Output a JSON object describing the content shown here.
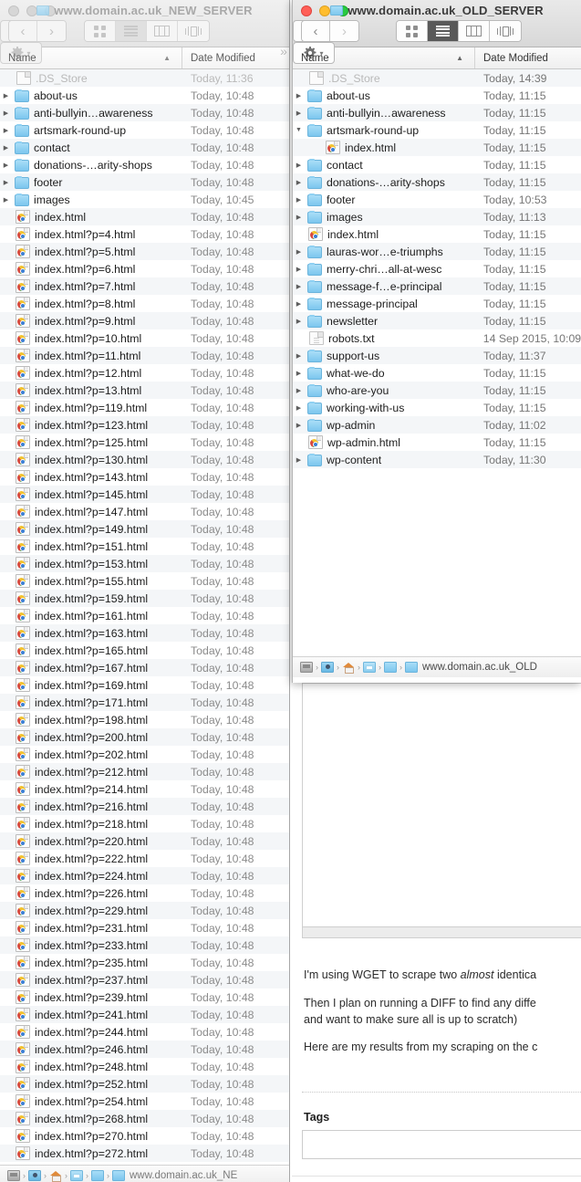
{
  "windows": [
    {
      "id": "new-server",
      "title": "www.domain.ac.uk_NEW_SERVER",
      "active": false,
      "columns": {
        "name": "Name",
        "date": "Date Modified"
      },
      "pathbar": {
        "label": "www.domain.ac.uk_NE"
      },
      "rows": [
        {
          "name": ".DS_Store",
          "date": "Today, 11:36",
          "icon": "document-icon",
          "ghost": true,
          "indent": 0,
          "disclosure": "none"
        },
        {
          "name": "about-us",
          "date": "Today, 10:48",
          "icon": "folder-icon",
          "indent": 0,
          "disclosure": "collapsed"
        },
        {
          "name": "anti-bullyin…awareness",
          "date": "Today, 10:48",
          "icon": "folder-icon",
          "indent": 0,
          "disclosure": "collapsed"
        },
        {
          "name": "artsmark-round-up",
          "date": "Today, 10:48",
          "icon": "folder-icon",
          "indent": 0,
          "disclosure": "collapsed"
        },
        {
          "name": "contact",
          "date": "Today, 10:48",
          "icon": "folder-icon",
          "indent": 0,
          "disclosure": "collapsed"
        },
        {
          "name": "donations-…arity-shops",
          "date": "Today, 10:48",
          "icon": "folder-icon",
          "indent": 0,
          "disclosure": "collapsed"
        },
        {
          "name": "footer",
          "date": "Today, 10:48",
          "icon": "folder-icon",
          "indent": 0,
          "disclosure": "collapsed"
        },
        {
          "name": "images",
          "date": "Today, 10:45",
          "icon": "folder-icon",
          "indent": 0,
          "disclosure": "collapsed"
        },
        {
          "name": "index.html",
          "date": "Today, 10:48",
          "icon": "html-file-icon",
          "indent": 0,
          "disclosure": "none"
        },
        {
          "name": "index.html?p=4.html",
          "date": "Today, 10:48",
          "icon": "html-file-icon",
          "indent": 0,
          "disclosure": "none"
        },
        {
          "name": "index.html?p=5.html",
          "date": "Today, 10:48",
          "icon": "html-file-icon",
          "indent": 0,
          "disclosure": "none"
        },
        {
          "name": "index.html?p=6.html",
          "date": "Today, 10:48",
          "icon": "html-file-icon",
          "indent": 0,
          "disclosure": "none"
        },
        {
          "name": "index.html?p=7.html",
          "date": "Today, 10:48",
          "icon": "html-file-icon",
          "indent": 0,
          "disclosure": "none"
        },
        {
          "name": "index.html?p=8.html",
          "date": "Today, 10:48",
          "icon": "html-file-icon",
          "indent": 0,
          "disclosure": "none"
        },
        {
          "name": "index.html?p=9.html",
          "date": "Today, 10:48",
          "icon": "html-file-icon",
          "indent": 0,
          "disclosure": "none"
        },
        {
          "name": "index.html?p=10.html",
          "date": "Today, 10:48",
          "icon": "html-file-icon",
          "indent": 0,
          "disclosure": "none"
        },
        {
          "name": "index.html?p=11.html",
          "date": "Today, 10:48",
          "icon": "html-file-icon",
          "indent": 0,
          "disclosure": "none"
        },
        {
          "name": "index.html?p=12.html",
          "date": "Today, 10:48",
          "icon": "html-file-icon",
          "indent": 0,
          "disclosure": "none"
        },
        {
          "name": "index.html?p=13.html",
          "date": "Today, 10:48",
          "icon": "html-file-icon",
          "indent": 0,
          "disclosure": "none"
        },
        {
          "name": "index.html?p=119.html",
          "date": "Today, 10:48",
          "icon": "html-file-icon",
          "indent": 0,
          "disclosure": "none"
        },
        {
          "name": "index.html?p=123.html",
          "date": "Today, 10:48",
          "icon": "html-file-icon",
          "indent": 0,
          "disclosure": "none"
        },
        {
          "name": "index.html?p=125.html",
          "date": "Today, 10:48",
          "icon": "html-file-icon",
          "indent": 0,
          "disclosure": "none"
        },
        {
          "name": "index.html?p=130.html",
          "date": "Today, 10:48",
          "icon": "html-file-icon",
          "indent": 0,
          "disclosure": "none"
        },
        {
          "name": "index.html?p=143.html",
          "date": "Today, 10:48",
          "icon": "html-file-icon",
          "indent": 0,
          "disclosure": "none"
        },
        {
          "name": "index.html?p=145.html",
          "date": "Today, 10:48",
          "icon": "html-file-icon",
          "indent": 0,
          "disclosure": "none"
        },
        {
          "name": "index.html?p=147.html",
          "date": "Today, 10:48",
          "icon": "html-file-icon",
          "indent": 0,
          "disclosure": "none"
        },
        {
          "name": "index.html?p=149.html",
          "date": "Today, 10:48",
          "icon": "html-file-icon",
          "indent": 0,
          "disclosure": "none"
        },
        {
          "name": "index.html?p=151.html",
          "date": "Today, 10:48",
          "icon": "html-file-icon",
          "indent": 0,
          "disclosure": "none"
        },
        {
          "name": "index.html?p=153.html",
          "date": "Today, 10:48",
          "icon": "html-file-icon",
          "indent": 0,
          "disclosure": "none"
        },
        {
          "name": "index.html?p=155.html",
          "date": "Today, 10:48",
          "icon": "html-file-icon",
          "indent": 0,
          "disclosure": "none"
        },
        {
          "name": "index.html?p=159.html",
          "date": "Today, 10:48",
          "icon": "html-file-icon",
          "indent": 0,
          "disclosure": "none"
        },
        {
          "name": "index.html?p=161.html",
          "date": "Today, 10:48",
          "icon": "html-file-icon",
          "indent": 0,
          "disclosure": "none"
        },
        {
          "name": "index.html?p=163.html",
          "date": "Today, 10:48",
          "icon": "html-file-icon",
          "indent": 0,
          "disclosure": "none"
        },
        {
          "name": "index.html?p=165.html",
          "date": "Today, 10:48",
          "icon": "html-file-icon",
          "indent": 0,
          "disclosure": "none"
        },
        {
          "name": "index.html?p=167.html",
          "date": "Today, 10:48",
          "icon": "html-file-icon",
          "indent": 0,
          "disclosure": "none"
        },
        {
          "name": "index.html?p=169.html",
          "date": "Today, 10:48",
          "icon": "html-file-icon",
          "indent": 0,
          "disclosure": "none"
        },
        {
          "name": "index.html?p=171.html",
          "date": "Today, 10:48",
          "icon": "html-file-icon",
          "indent": 0,
          "disclosure": "none"
        },
        {
          "name": "index.html?p=198.html",
          "date": "Today, 10:48",
          "icon": "html-file-icon",
          "indent": 0,
          "disclosure": "none"
        },
        {
          "name": "index.html?p=200.html",
          "date": "Today, 10:48",
          "icon": "html-file-icon",
          "indent": 0,
          "disclosure": "none"
        },
        {
          "name": "index.html?p=202.html",
          "date": "Today, 10:48",
          "icon": "html-file-icon",
          "indent": 0,
          "disclosure": "none"
        },
        {
          "name": "index.html?p=212.html",
          "date": "Today, 10:48",
          "icon": "html-file-icon",
          "indent": 0,
          "disclosure": "none"
        },
        {
          "name": "index.html?p=214.html",
          "date": "Today, 10:48",
          "icon": "html-file-icon",
          "indent": 0,
          "disclosure": "none"
        },
        {
          "name": "index.html?p=216.html",
          "date": "Today, 10:48",
          "icon": "html-file-icon",
          "indent": 0,
          "disclosure": "none"
        },
        {
          "name": "index.html?p=218.html",
          "date": "Today, 10:48",
          "icon": "html-file-icon",
          "indent": 0,
          "disclosure": "none"
        },
        {
          "name": "index.html?p=220.html",
          "date": "Today, 10:48",
          "icon": "html-file-icon",
          "indent": 0,
          "disclosure": "none"
        },
        {
          "name": "index.html?p=222.html",
          "date": "Today, 10:48",
          "icon": "html-file-icon",
          "indent": 0,
          "disclosure": "none"
        },
        {
          "name": "index.html?p=224.html",
          "date": "Today, 10:48",
          "icon": "html-file-icon",
          "indent": 0,
          "disclosure": "none"
        },
        {
          "name": "index.html?p=226.html",
          "date": "Today, 10:48",
          "icon": "html-file-icon",
          "indent": 0,
          "disclosure": "none"
        },
        {
          "name": "index.html?p=229.html",
          "date": "Today, 10:48",
          "icon": "html-file-icon",
          "indent": 0,
          "disclosure": "none"
        },
        {
          "name": "index.html?p=231.html",
          "date": "Today, 10:48",
          "icon": "html-file-icon",
          "indent": 0,
          "disclosure": "none"
        },
        {
          "name": "index.html?p=233.html",
          "date": "Today, 10:48",
          "icon": "html-file-icon",
          "indent": 0,
          "disclosure": "none"
        },
        {
          "name": "index.html?p=235.html",
          "date": "Today, 10:48",
          "icon": "html-file-icon",
          "indent": 0,
          "disclosure": "none"
        },
        {
          "name": "index.html?p=237.html",
          "date": "Today, 10:48",
          "icon": "html-file-icon",
          "indent": 0,
          "disclosure": "none"
        },
        {
          "name": "index.html?p=239.html",
          "date": "Today, 10:48",
          "icon": "html-file-icon",
          "indent": 0,
          "disclosure": "none"
        },
        {
          "name": "index.html?p=241.html",
          "date": "Today, 10:48",
          "icon": "html-file-icon",
          "indent": 0,
          "disclosure": "none"
        },
        {
          "name": "index.html?p=244.html",
          "date": "Today, 10:48",
          "icon": "html-file-icon",
          "indent": 0,
          "disclosure": "none"
        },
        {
          "name": "index.html?p=246.html",
          "date": "Today, 10:48",
          "icon": "html-file-icon",
          "indent": 0,
          "disclosure": "none"
        },
        {
          "name": "index.html?p=248.html",
          "date": "Today, 10:48",
          "icon": "html-file-icon",
          "indent": 0,
          "disclosure": "none"
        },
        {
          "name": "index.html?p=252.html",
          "date": "Today, 10:48",
          "icon": "html-file-icon",
          "indent": 0,
          "disclosure": "none"
        },
        {
          "name": "index.html?p=254.html",
          "date": "Today, 10:48",
          "icon": "html-file-icon",
          "indent": 0,
          "disclosure": "none"
        },
        {
          "name": "index.html?p=268.html",
          "date": "Today, 10:48",
          "icon": "html-file-icon",
          "indent": 0,
          "disclosure": "none"
        },
        {
          "name": "index.html?p=270.html",
          "date": "Today, 10:48",
          "icon": "html-file-icon",
          "indent": 0,
          "disclosure": "none"
        },
        {
          "name": "index.html?p=272.html",
          "date": "Today, 10:48",
          "icon": "html-file-icon",
          "indent": 0,
          "disclosure": "none"
        }
      ]
    },
    {
      "id": "old-server",
      "title": "www.domain.ac.uk_OLD_SERVER",
      "active": true,
      "columns": {
        "name": "Name",
        "date": "Date Modified"
      },
      "pathbar": {
        "label": "www.domain.ac.uk_OLD"
      },
      "rows": [
        {
          "name": ".DS_Store",
          "date": "Today, 14:39",
          "icon": "document-icon",
          "ghost": true,
          "indent": 0,
          "disclosure": "none"
        },
        {
          "name": "about-us",
          "date": "Today, 11:15",
          "icon": "folder-icon",
          "indent": 0,
          "disclosure": "collapsed"
        },
        {
          "name": "anti-bullyin…awareness",
          "date": "Today, 11:15",
          "icon": "folder-icon",
          "indent": 0,
          "disclosure": "collapsed"
        },
        {
          "name": "artsmark-round-up",
          "date": "Today, 11:15",
          "icon": "folder-icon",
          "indent": 0,
          "disclosure": "expanded"
        },
        {
          "name": "index.html",
          "date": "Today, 11:15",
          "icon": "html-file-icon",
          "indent": 1,
          "disclosure": "none"
        },
        {
          "name": "contact",
          "date": "Today, 11:15",
          "icon": "folder-icon",
          "indent": 0,
          "disclosure": "collapsed"
        },
        {
          "name": "donations-…arity-shops",
          "date": "Today, 11:15",
          "icon": "folder-icon",
          "indent": 0,
          "disclosure": "collapsed"
        },
        {
          "name": "footer",
          "date": "Today, 10:53",
          "icon": "folder-icon",
          "indent": 0,
          "disclosure": "collapsed"
        },
        {
          "name": "images",
          "date": "Today, 11:13",
          "icon": "folder-icon",
          "indent": 0,
          "disclosure": "collapsed"
        },
        {
          "name": "index.html",
          "date": "Today, 11:15",
          "icon": "html-file-icon",
          "indent": 0,
          "disclosure": "none"
        },
        {
          "name": "lauras-wor…e-triumphs",
          "date": "Today, 11:15",
          "icon": "folder-icon",
          "indent": 0,
          "disclosure": "collapsed"
        },
        {
          "name": "merry-chri…all-at-wesc",
          "date": "Today, 11:15",
          "icon": "folder-icon",
          "indent": 0,
          "disclosure": "collapsed"
        },
        {
          "name": "message-f…e-principal",
          "date": "Today, 11:15",
          "icon": "folder-icon",
          "indent": 0,
          "disclosure": "collapsed"
        },
        {
          "name": "message-principal",
          "date": "Today, 11:15",
          "icon": "folder-icon",
          "indent": 0,
          "disclosure": "collapsed"
        },
        {
          "name": "newsletter",
          "date": "Today, 11:15",
          "icon": "folder-icon",
          "indent": 0,
          "disclosure": "collapsed"
        },
        {
          "name": "robots.txt",
          "date": "14 Sep 2015, 10:09",
          "icon": "text-file-icon",
          "indent": 0,
          "disclosure": "none"
        },
        {
          "name": "support-us",
          "date": "Today, 11:37",
          "icon": "folder-icon",
          "indent": 0,
          "disclosure": "collapsed"
        },
        {
          "name": "what-we-do",
          "date": "Today, 11:15",
          "icon": "folder-icon",
          "indent": 0,
          "disclosure": "collapsed"
        },
        {
          "name": "who-are-you",
          "date": "Today, 11:15",
          "icon": "folder-icon",
          "indent": 0,
          "disclosure": "collapsed"
        },
        {
          "name": "working-with-us",
          "date": "Today, 11:15",
          "icon": "folder-icon",
          "indent": 0,
          "disclosure": "collapsed"
        },
        {
          "name": "wp-admin",
          "date": "Today, 11:02",
          "icon": "folder-icon",
          "indent": 0,
          "disclosure": "collapsed"
        },
        {
          "name": "wp-admin.html",
          "date": "Today, 11:15",
          "icon": "html-file-icon",
          "indent": 0,
          "disclosure": "none"
        },
        {
          "name": "wp-content",
          "date": "Today, 11:30",
          "icon": "folder-icon",
          "indent": 0,
          "disclosure": "collapsed"
        }
      ]
    }
  ],
  "toolbar": {
    "back_label": "‹",
    "forward_label": "›",
    "view_icon_label": "icon-view-icon",
    "view_list_label": "list-view-icon",
    "view_column_label": "column-view-icon",
    "view_coverflow_label": "coverflow-view-icon",
    "arrange_label": "arrange-by-icon",
    "action_label": "gear-icon",
    "overflow_label": "»"
  },
  "post": {
    "paragraphs": [
      "I'm using WGET to scrape two almost identical",
      "Then I plan on running a DIFF to find any diffe",
      "and want to make sure all is up to scratch)",
      "Here are my results from my scraping on the c"
    ],
    "para1_pre": "I'm using WGET to scrape two ",
    "para1_em": "almost",
    "para1_post": " identica",
    "tags_label": "Tags",
    "tags_value": "",
    "tags_placeholder": ""
  },
  "colors": {
    "folder_blue": "#7cc6ee",
    "row_stripe": "#f4f6f8",
    "traffic_close": "#ff5f57",
    "traffic_min": "#ffbd2e",
    "traffic_max": "#28ca42",
    "active_segment": "#595959"
  }
}
